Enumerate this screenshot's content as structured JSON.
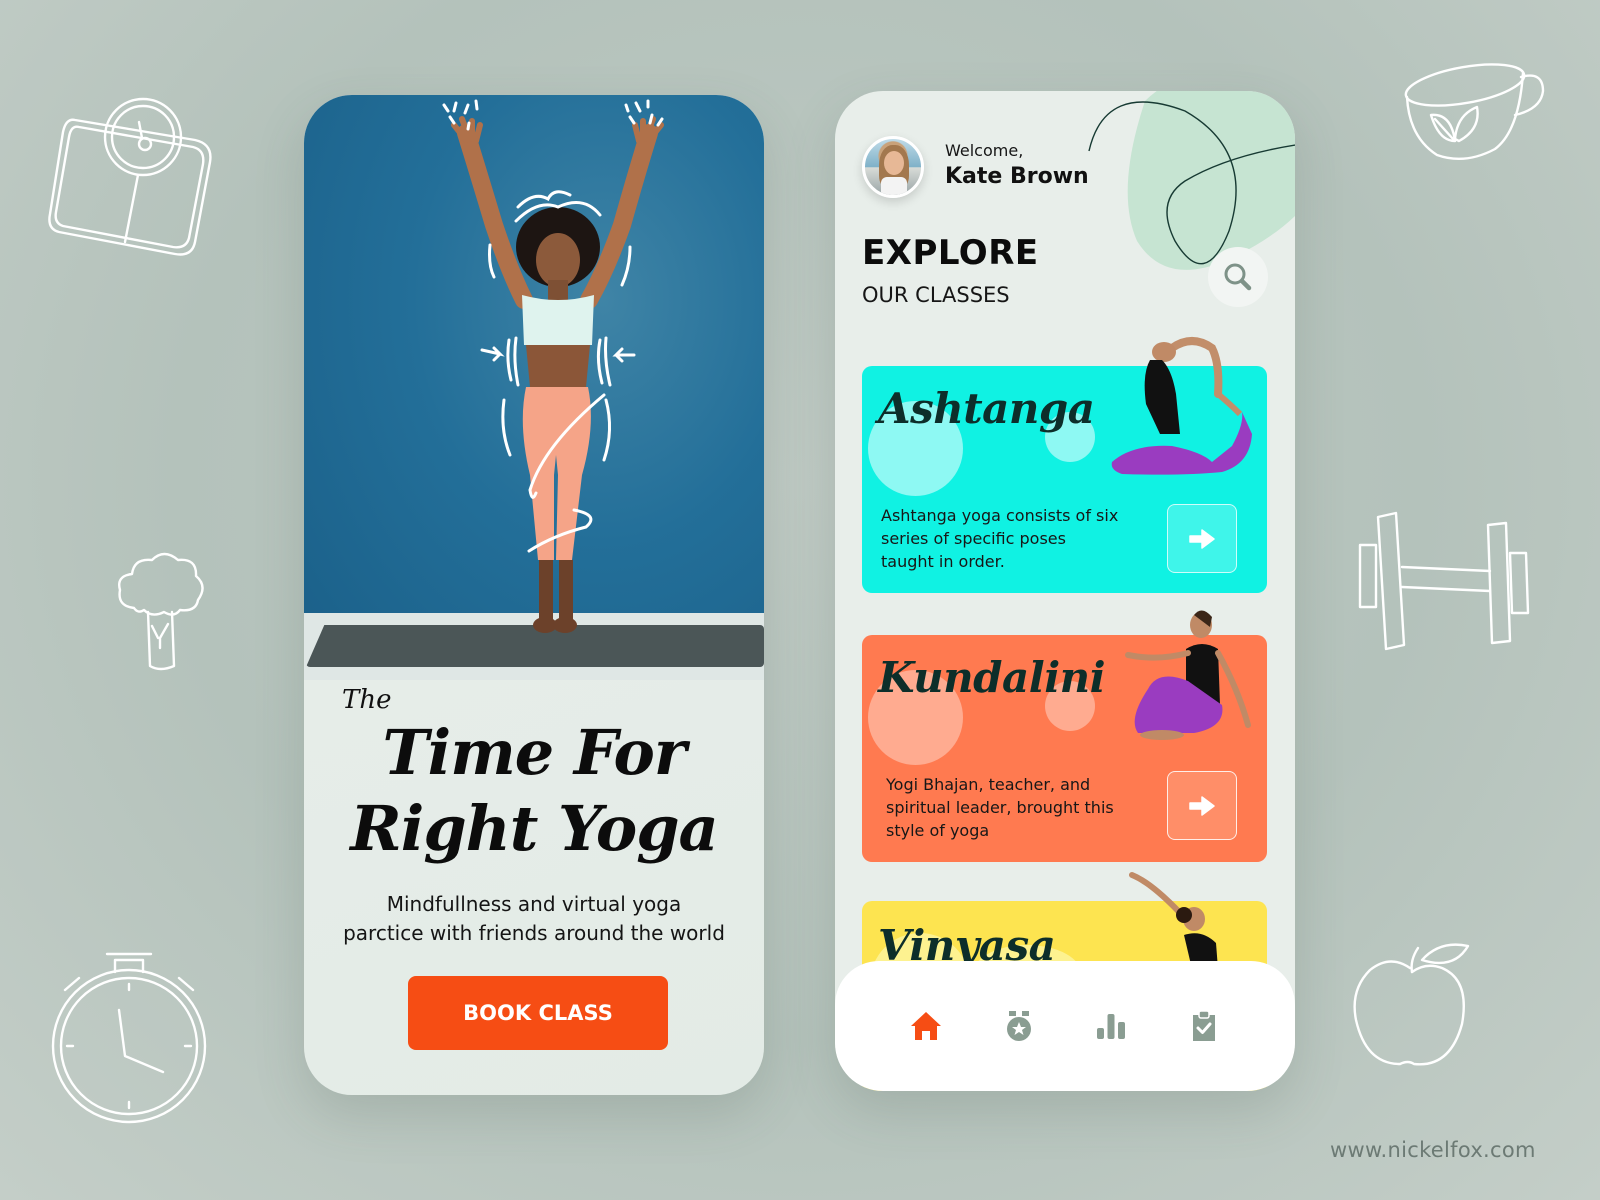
{
  "colors": {
    "accent": "#f64d14",
    "nav_inactive": "#8a9d92",
    "ashtanga": "#10f2e3",
    "kundalini": "#ff7a50",
    "vinyasa": "#fde450"
  },
  "onboarding": {
    "title_prefix": "The",
    "title_line1": "Time For",
    "title_line2": "Right Yoga",
    "tagline_line1": "Mindfullness and virtual yoga",
    "tagline_line2": "parctice with friends around the world",
    "book_button": "BOOK CLASS"
  },
  "explore": {
    "welcome": "Welcome,",
    "user_name": "Kate Brown",
    "heading": "EXPLORE",
    "subheading": "OUR CLASSES",
    "search_icon": "search-icon",
    "classes": [
      {
        "name": "Ashtanga",
        "description": "Ashtanga yoga consists of six series of specific poses taught in order.",
        "color": "#10f2e3",
        "action_icon": "arrow-right-icon"
      },
      {
        "name": "Kundalini",
        "description": "Yogi Bhajan, teacher, and spiritual leader, brought this style of yoga",
        "color": "#ff7a50",
        "action_icon": "arrow-right-icon"
      },
      {
        "name": "Vinyasa",
        "description": "",
        "color": "#fde450",
        "action_icon": "arrow-right-icon"
      }
    ],
    "nav": [
      {
        "icon": "home-icon",
        "active": true
      },
      {
        "icon": "medal-icon",
        "active": false
      },
      {
        "icon": "bar-chart-icon",
        "active": false
      },
      {
        "icon": "clipboard-check-icon",
        "active": false
      }
    ]
  },
  "background_doodles": [
    "scale-icon",
    "broccoli-icon",
    "stopwatch-icon",
    "tea-cup-icon",
    "dumbbell-icon",
    "apple-icon"
  ],
  "watermark": "www.nickelfox.com"
}
